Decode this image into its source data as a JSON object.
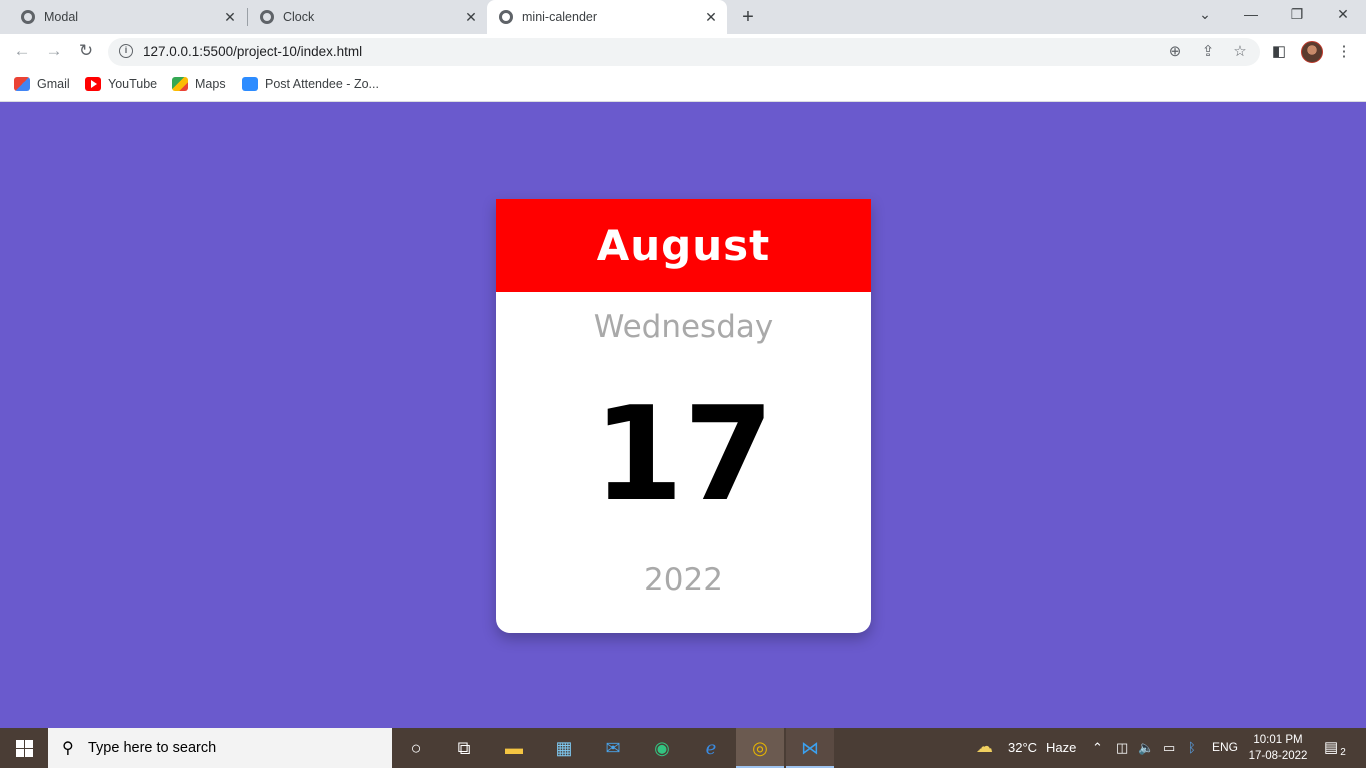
{
  "browser": {
    "tabs": [
      {
        "title": "Modal",
        "active": false
      },
      {
        "title": "Clock",
        "active": false
      },
      {
        "title": "mini-calender",
        "active": true
      }
    ],
    "url": "127.0.0.1:5500/project-10/index.html",
    "bookmarks": [
      {
        "label": "Gmail",
        "icon": "gmail-icon"
      },
      {
        "label": "YouTube",
        "icon": "youtube-icon"
      },
      {
        "label": "Maps",
        "icon": "maps-icon"
      },
      {
        "label": "Post Attendee - Zo...",
        "icon": "zoom-icon"
      }
    ]
  },
  "calendar": {
    "month": "August",
    "weekday": "Wednesday",
    "day": "17",
    "year": "2022"
  },
  "colors": {
    "page_background": "#6a5acd",
    "month_header": "#ff0000",
    "card": "#ffffff",
    "muted_text": "#a9a9a9"
  },
  "taskbar": {
    "search_placeholder": "Type here to search",
    "weather_temp": "32°C",
    "weather_text": "Haze",
    "language": "ENG",
    "time": "10:01 PM",
    "date": "17-08-2022",
    "notification_count": "2"
  }
}
